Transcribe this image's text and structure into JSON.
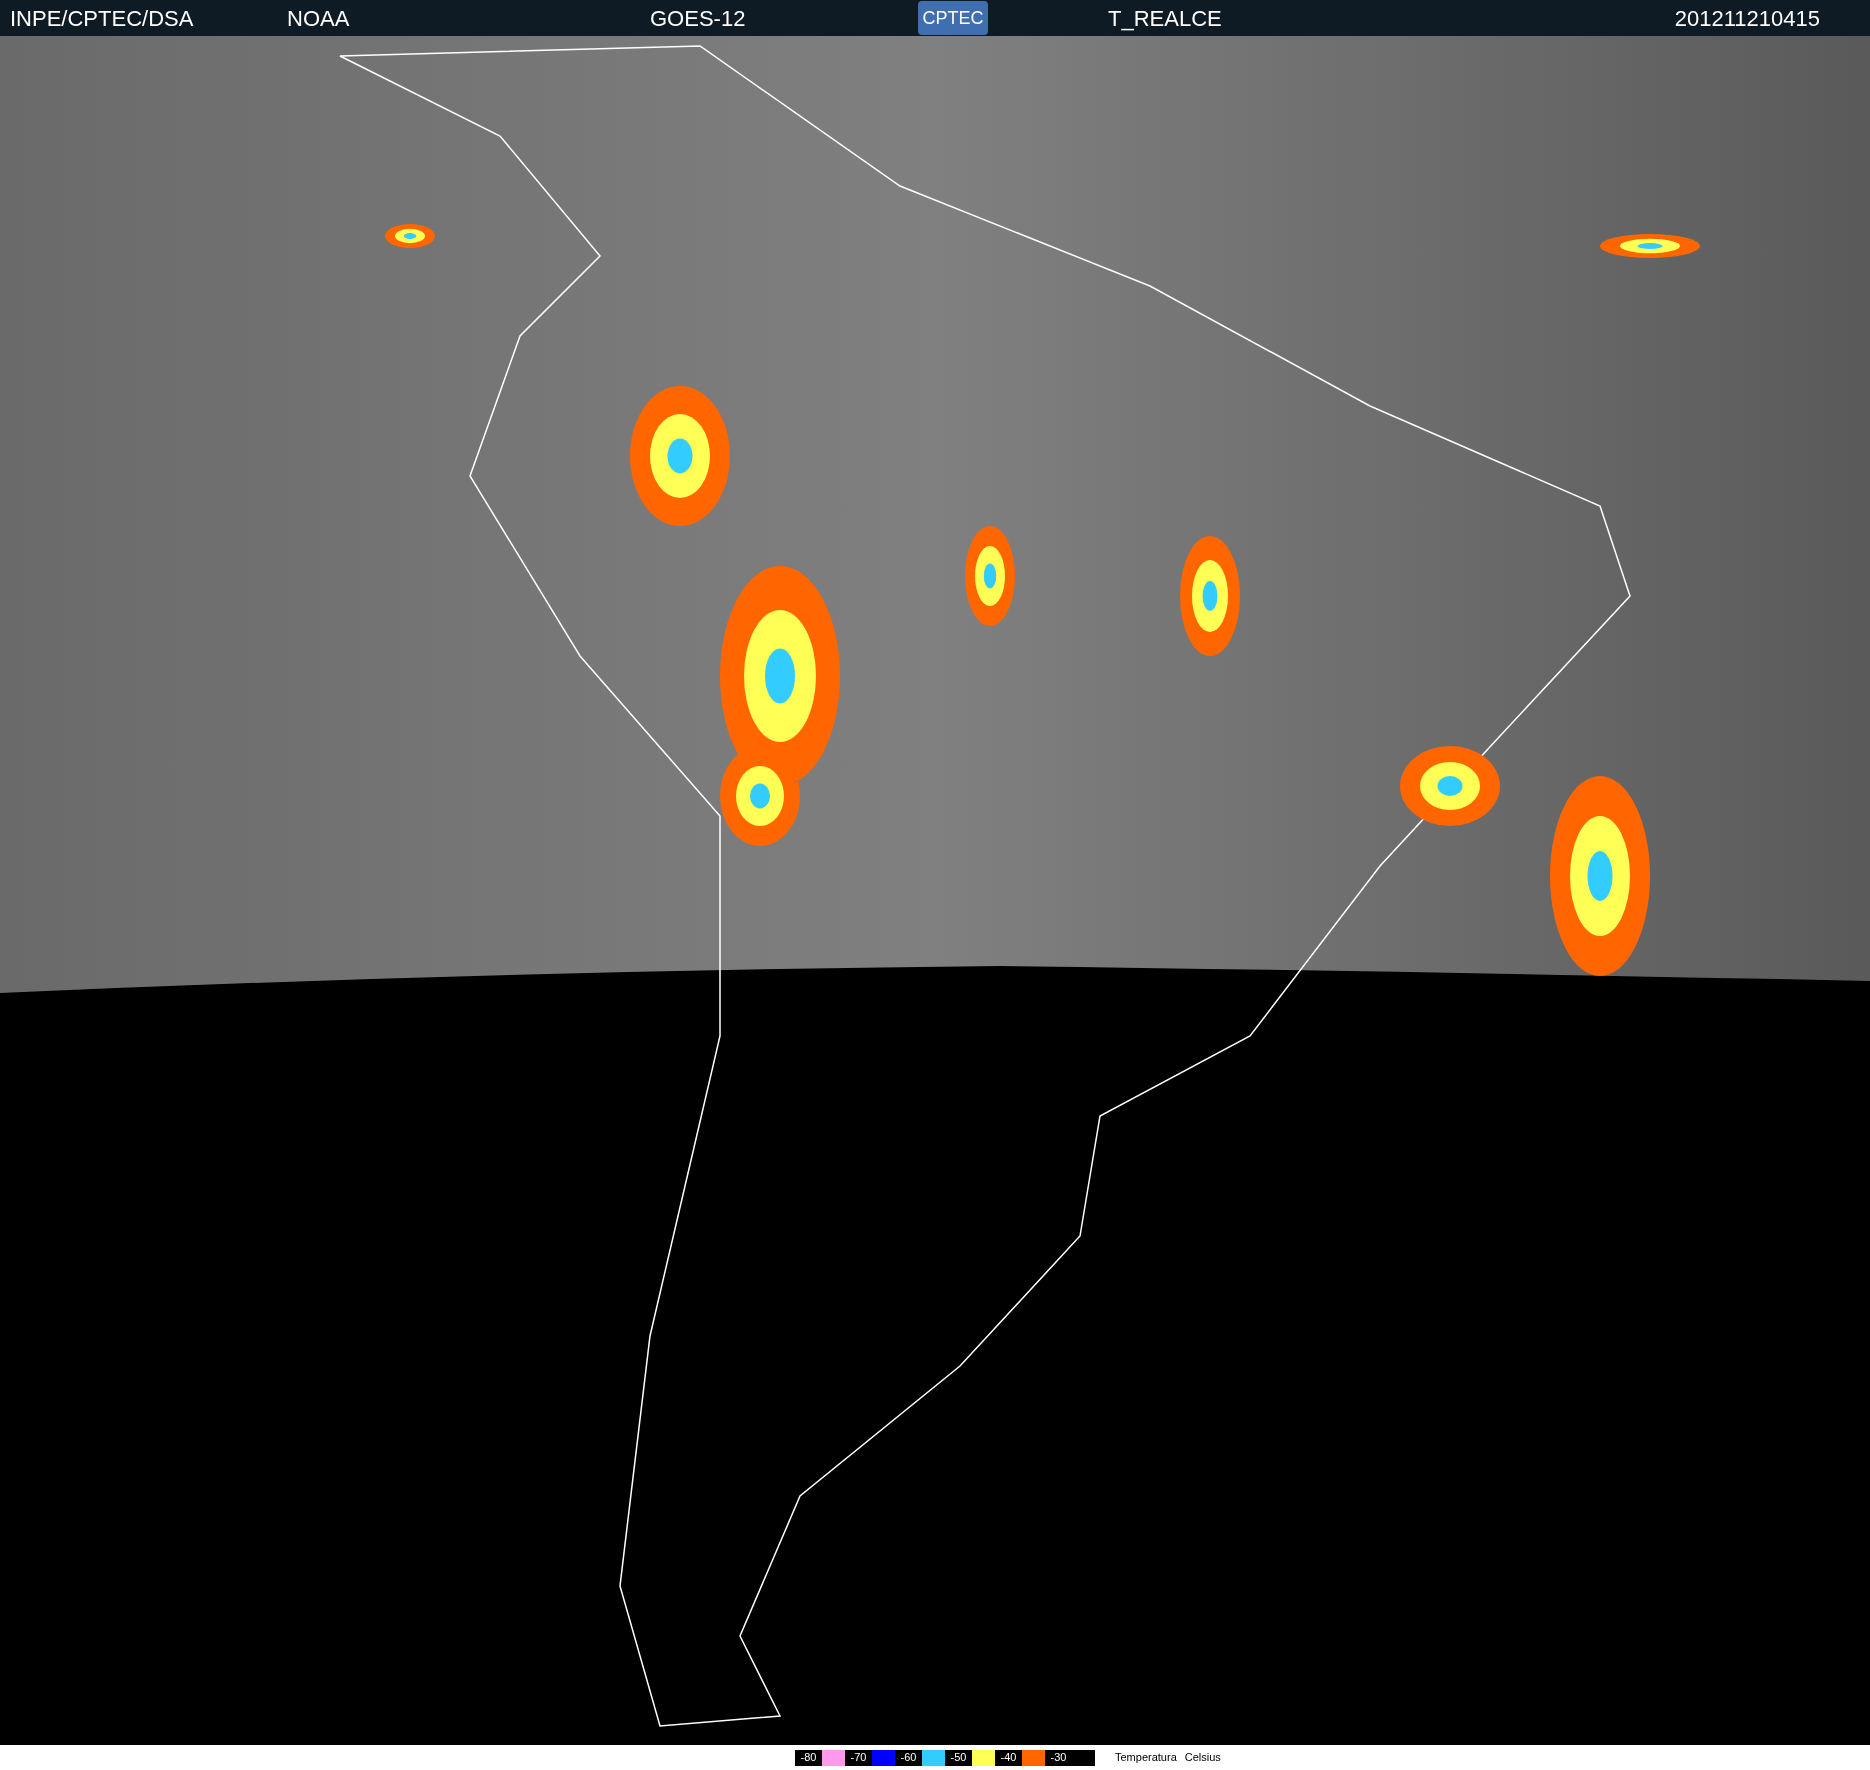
{
  "header": {
    "items": [
      "INPE/CPTEC/DSA",
      "NOAA",
      "GOES-12"
    ],
    "logo": "CPTEC",
    "product": "T_REALCE",
    "timestamp": "201211210415"
  },
  "legend": {
    "items": [
      {
        "label": "-80",
        "color": "#ff99ee"
      },
      {
        "label": "-70",
        "color": "#0000ff"
      },
      {
        "label": "-60",
        "color": "#33ccff"
      },
      {
        "label": "-50",
        "color": "#ffff55"
      },
      {
        "label": "-40",
        "color": "#ff6600"
      },
      {
        "label": "-30",
        "color": "#000000"
      }
    ],
    "title": "Temperatura",
    "unit": "Celsius"
  }
}
